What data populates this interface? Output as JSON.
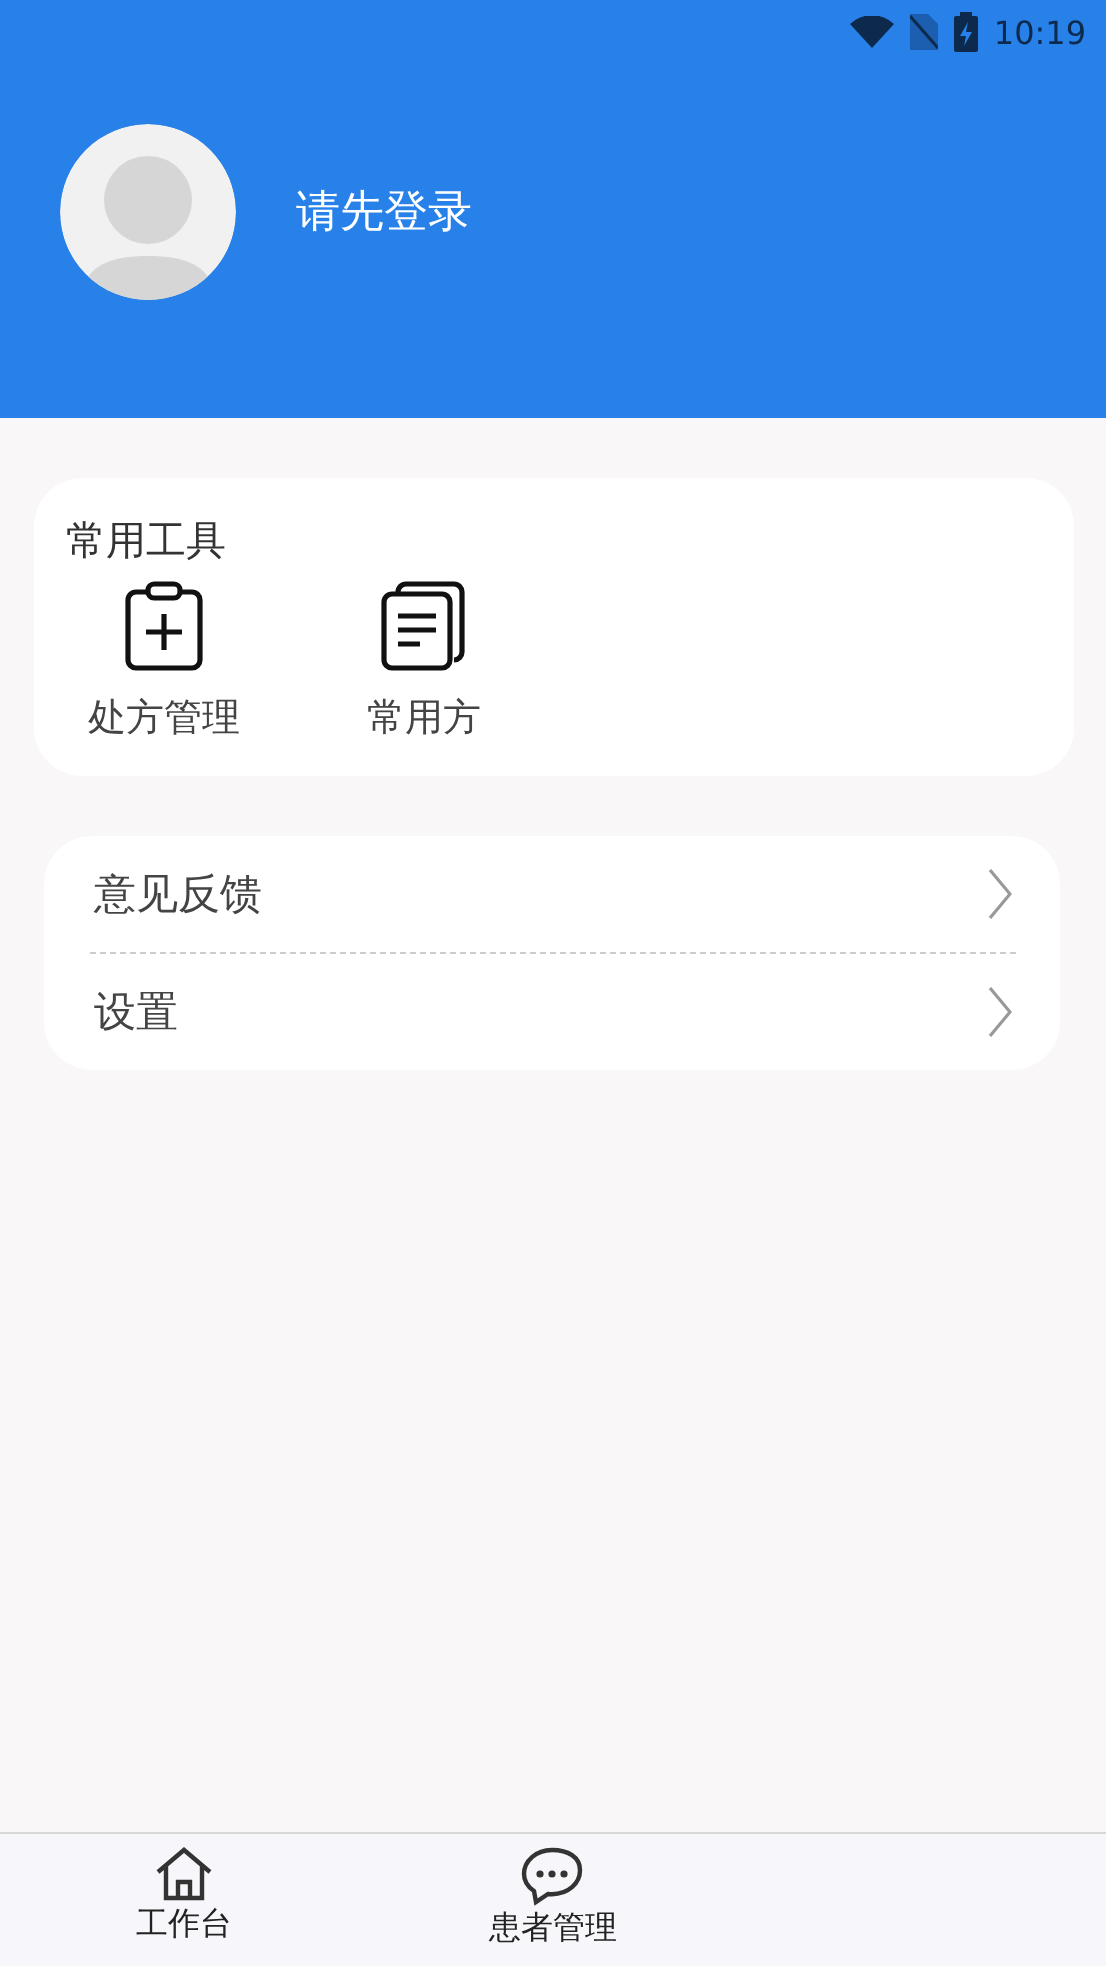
{
  "status_bar": {
    "time": "10:19"
  },
  "profile": {
    "login_prompt": "请先登录"
  },
  "tools": {
    "title": "常用工具",
    "items": [
      {
        "kind": "prescription",
        "label": "处方管理"
      },
      {
        "kind": "documents",
        "label": "常用方"
      }
    ]
  },
  "menu": [
    {
      "label": "意见反馈"
    },
    {
      "label": "设置"
    }
  ],
  "bottom_nav": [
    {
      "kind": "home",
      "label": "工作台"
    },
    {
      "kind": "chat",
      "label": "患者管理"
    }
  ]
}
